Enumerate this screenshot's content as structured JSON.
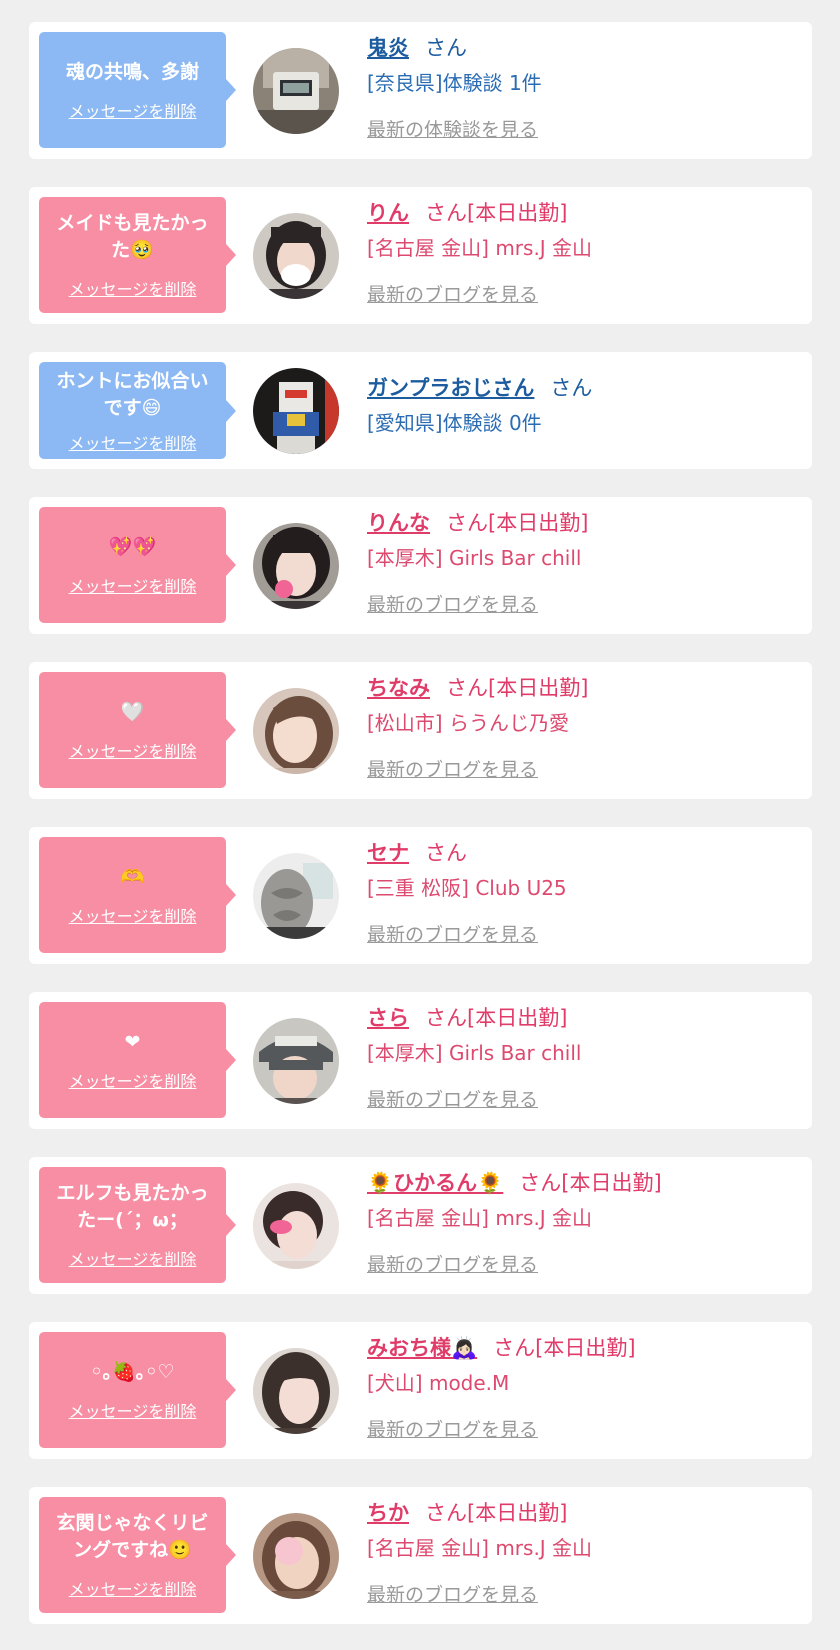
{
  "delete_label": "メッセージを削除",
  "colors": {
    "blue_bubble": "#8cb9f3",
    "pink_bubble": "#f88ea3",
    "blue_name": "#1d5c9f",
    "pink_name": "#e03c69",
    "link_gray": "#999999",
    "background": "#efefef"
  },
  "cards": [
    {
      "message": "魂の共鳴、多謝",
      "delete": "メッセージを削除",
      "name": "鬼炎",
      "suffix": "さん",
      "shop": "[奈良県]体験談 1件",
      "link": "最新の体験談を見る",
      "theme": "blue"
    },
    {
      "message": "メイドも見たかった🥹",
      "delete": "メッセージを削除",
      "name": "りん",
      "suffix": "さん[本日出勤]",
      "shop": "[名古屋 金山] mrs.J 金山",
      "link": "最新のブログを見る",
      "theme": "pink"
    },
    {
      "message": "ホントにお似合いです😄",
      "delete": "メッセージを削除",
      "name": "ガンプラおじさん",
      "suffix": "さん",
      "shop": "[愛知県]体験談 0件",
      "link": "",
      "theme": "blue"
    },
    {
      "message": "💖💖",
      "delete": "メッセージを削除",
      "name": "りんな",
      "suffix": "さん[本日出勤]",
      "shop": "[本厚木] Girls Bar chill",
      "link": "最新のブログを見る",
      "theme": "pink"
    },
    {
      "message": "🤍",
      "delete": "メッセージを削除",
      "name": "ちなみ",
      "suffix": "さん[本日出勤]",
      "shop": "[松山市] らうんじ乃愛",
      "link": "最新のブログを見る",
      "theme": "pink"
    },
    {
      "message": "🫶",
      "delete": "メッセージを削除",
      "name": "セナ",
      "suffix": "さん",
      "shop": "[三重 松阪] Club U25",
      "link": "最新のブログを見る",
      "theme": "pink"
    },
    {
      "message": "❤",
      "delete": "メッセージを削除",
      "name": "さら",
      "suffix": "さん[本日出勤]",
      "shop": "[本厚木] Girls Bar chill",
      "link": "最新のブログを見る",
      "theme": "pink"
    },
    {
      "message": "エルフも見たかったー(´；ω；",
      "delete": "メッセージを削除",
      "name": "🌻ひかるん🌻",
      "suffix": "さん[本日出勤]",
      "shop": "[名古屋 金山] mrs.J 金山",
      "link": "最新のブログを見る",
      "theme": "pink"
    },
    {
      "message": "◦｡🍓｡◦♡",
      "delete": "メッセージを削除",
      "name": "みおち様🙇🏻‍♀️",
      "suffix": "さん[本日出勤]",
      "shop": "[犬山] mode.M",
      "link": "最新のブログを見る",
      "theme": "pink"
    },
    {
      "message": "玄関じゃなくリビングですね🙂",
      "delete": "メッセージを削除",
      "name": "ちか",
      "suffix": "さん[本日出勤]",
      "shop": "[名古屋 金山] mrs.J 金山",
      "link": "最新のブログを見る",
      "theme": "pink"
    }
  ]
}
